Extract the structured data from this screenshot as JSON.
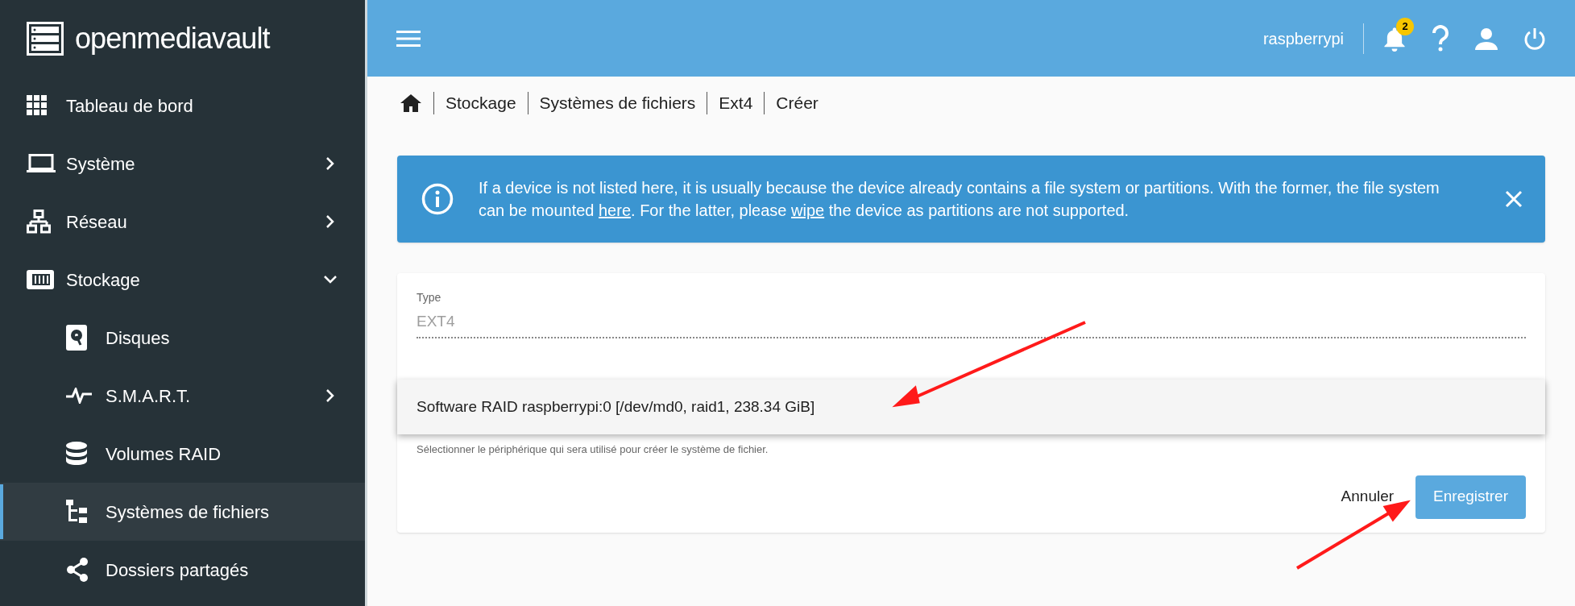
{
  "sidebar": {
    "brand": "openmediavault",
    "items": [
      {
        "label": "Tableau de bord",
        "selected": false
      },
      {
        "label": "Système",
        "selected": false,
        "expanded": false
      },
      {
        "label": "Réseau",
        "selected": false,
        "expanded": false
      },
      {
        "label": "Stockage",
        "selected": false,
        "expanded": true,
        "children": [
          {
            "label": "Disques",
            "selected": false
          },
          {
            "label": "S.M.A.R.T.",
            "selected": false,
            "expanded": false
          },
          {
            "label": "Volumes RAID",
            "selected": false
          },
          {
            "label": "Systèmes de fichiers",
            "selected": true
          },
          {
            "label": "Dossiers partagés",
            "selected": false
          }
        ]
      }
    ]
  },
  "header": {
    "hostname": "raspberrypi",
    "notification_count": "2"
  },
  "breadcrumb": [
    "Stockage",
    "Systèmes de fichiers",
    "Ext4",
    "Créer"
  ],
  "alert": {
    "segments": [
      {
        "text": "If a device is not listed here, it is usually because the device already contains a file system or partitions. With the former, the file system can be mounted ",
        "link": false
      },
      {
        "text": "here",
        "link": true
      },
      {
        "text": ". For the latter, please ",
        "link": false
      },
      {
        "text": "wipe",
        "link": true
      },
      {
        "text": " the device as partitions are not supported.",
        "link": false
      }
    ]
  },
  "form": {
    "type_field": {
      "label": "Type",
      "value": "EXT4",
      "disabled": true
    },
    "device_field": {
      "hint": "Sélectionner le périphérique qui sera utilisé pour créer le système de fichier.",
      "options": [
        "Software RAID raspberrypi:0 [/dev/md0, raid1, 238.34 GiB]"
      ]
    },
    "buttons": [
      {
        "label": "Annuler",
        "kind": "text"
      },
      {
        "label": "Enregistrer",
        "kind": "primary"
      }
    ]
  }
}
